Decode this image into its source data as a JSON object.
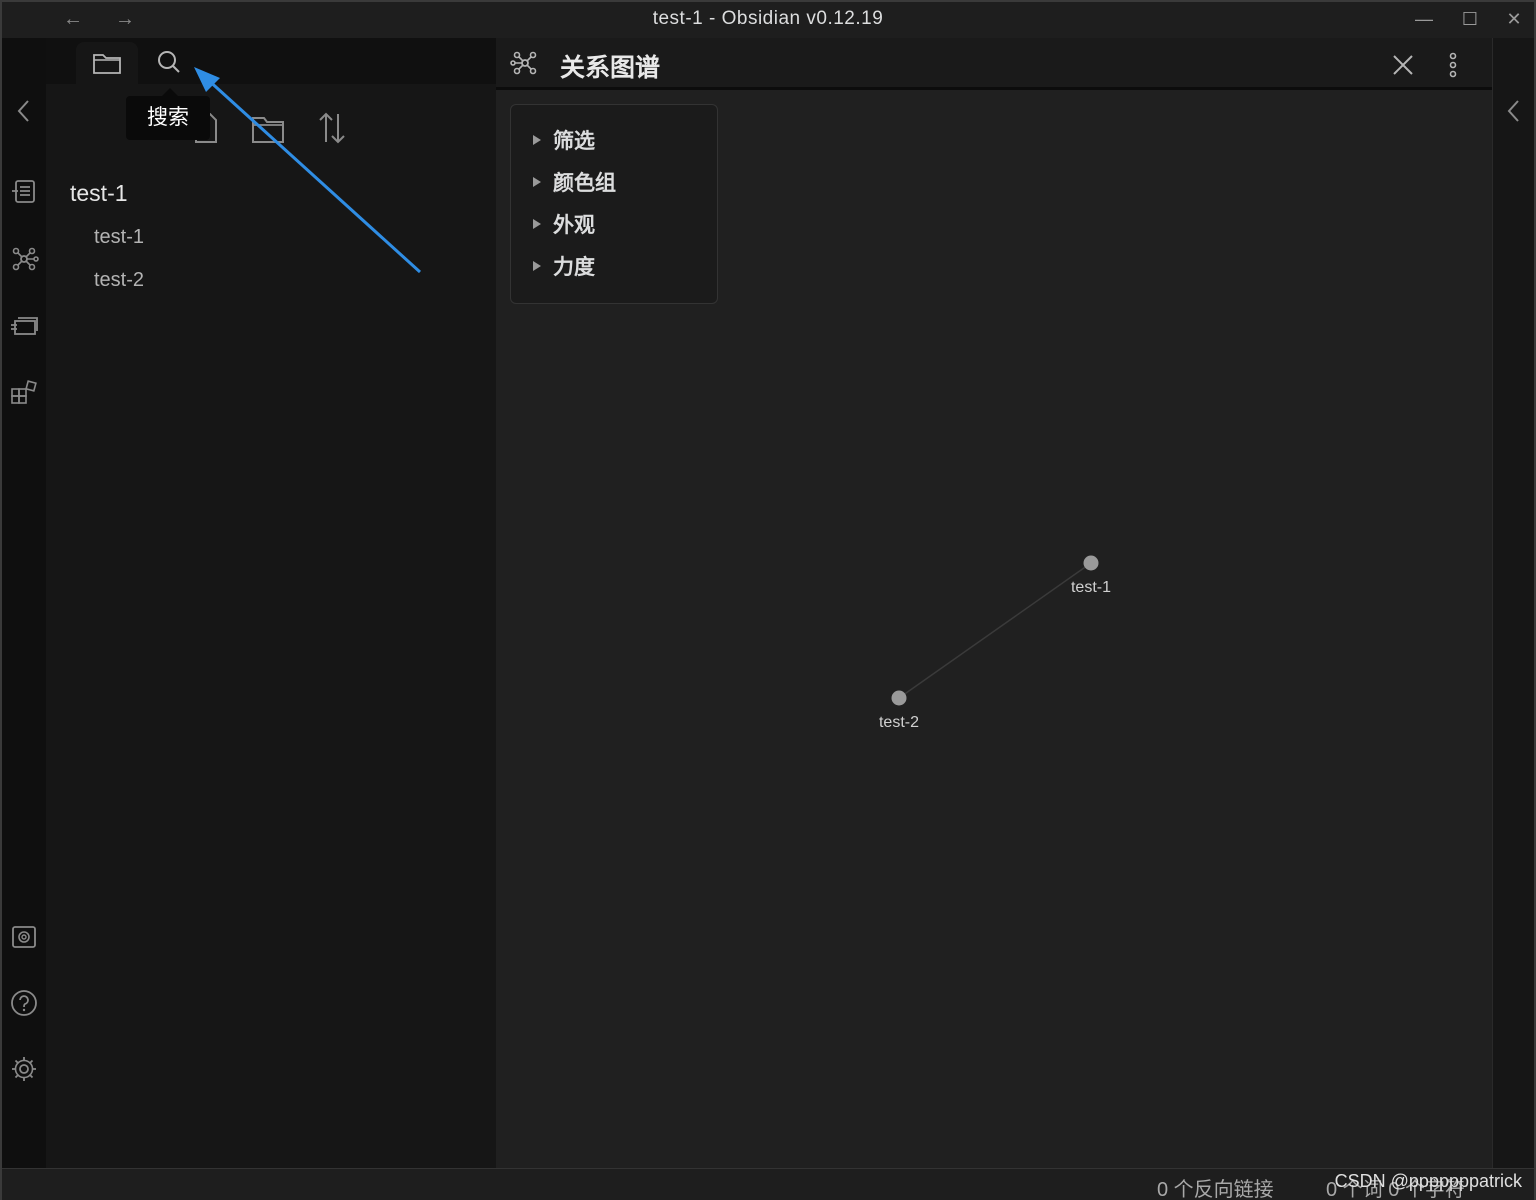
{
  "window": {
    "title": "test-1 - Obsidian v0.12.19",
    "back_icon": "←",
    "forward_icon": "→",
    "minimize_icon": "—",
    "maximize_icon": "☐",
    "close_icon": "✕"
  },
  "ribbon": {
    "icons": [
      "chevron-left-icon",
      "open-quick-switcher-icon",
      "graph-view-icon",
      "slides-icon",
      "workspaces-icon",
      "vault-icon",
      "help-icon",
      "settings-icon"
    ]
  },
  "sidebar": {
    "tabs": [
      "folder-icon",
      "search-icon"
    ],
    "tooltip": "搜索",
    "actions": [
      "new-note-icon",
      "new-folder-icon",
      "sort-icon"
    ],
    "tree": {
      "root": "test-1",
      "items": [
        "test-1",
        "test-2"
      ]
    }
  },
  "graph": {
    "title": "关系图谱",
    "controls": [
      "筛选",
      "颜色组",
      "外观",
      "力度"
    ],
    "nodes": [
      {
        "label": "test-1"
      },
      {
        "label": "test-2"
      }
    ],
    "edges": [
      [
        "test-1",
        "test-2"
      ]
    ],
    "colors": {
      "node": "#9a9a9a",
      "edge": "#3a3a3a",
      "arrow": "#2f8de4"
    }
  },
  "status": {
    "backlinks": "0 个反向链接",
    "words": "0 个词  0 个字符",
    "watermark": "CSDN @pppppppatrick"
  }
}
